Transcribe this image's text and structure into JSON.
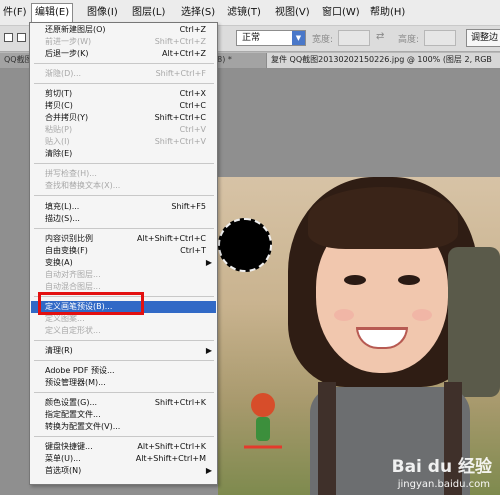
{
  "menubar": {
    "items": [
      "件(F)",
      "编辑(E)",
      "图像(I)",
      "图层(L)",
      "选择(S)",
      "滤镜(T)",
      "视图(V)",
      "窗口(W)",
      "帮助(H)"
    ]
  },
  "options": {
    "mode_value": "正常",
    "width_label": "宽度:",
    "height_label": "高度:",
    "swap_symbol": "⇄",
    "adjust_button": "调整边"
  },
  "tabs": {
    "left": "QQ截图",
    "mid": "(8) *",
    "right": "复件 QQ截图20130202150226.jpg @ 100% (图层 2, RGB"
  },
  "menu": {
    "items": [
      {
        "label": "还原新建图层(O)",
        "shortcut": "Ctrl+Z",
        "disabled": false
      },
      {
        "label": "前进一步(W)",
        "shortcut": "Shift+Ctrl+Z",
        "disabled": true
      },
      {
        "label": "后退一步(K)",
        "shortcut": "Alt+Ctrl+Z",
        "disabled": false
      },
      {
        "label": "渐隐(D)...",
        "shortcut": "Shift+Ctrl+F",
        "disabled": true
      },
      {
        "label": "剪切(T)",
        "shortcut": "Ctrl+X",
        "disabled": false
      },
      {
        "label": "拷贝(C)",
        "shortcut": "Ctrl+C",
        "disabled": false
      },
      {
        "label": "合并拷贝(Y)",
        "shortcut": "Shift+Ctrl+C",
        "disabled": false
      },
      {
        "label": "粘贴(P)",
        "shortcut": "Ctrl+V",
        "disabled": true
      },
      {
        "label": "贴入(I)",
        "shortcut": "Shift+Ctrl+V",
        "disabled": true
      },
      {
        "label": "清除(E)",
        "shortcut": "",
        "disabled": false
      },
      {
        "label": "拼写检查(H)...",
        "shortcut": "",
        "disabled": true
      },
      {
        "label": "查找和替换文本(X)...",
        "shortcut": "",
        "disabled": true
      },
      {
        "label": "填充(L)...",
        "shortcut": "Shift+F5",
        "disabled": false
      },
      {
        "label": "描边(S)...",
        "shortcut": "",
        "disabled": false
      },
      {
        "label": "内容识别比例",
        "shortcut": "Alt+Shift+Ctrl+C",
        "disabled": false
      },
      {
        "label": "自由变换(F)",
        "shortcut": "Ctrl+T",
        "disabled": false
      },
      {
        "label": "变换(A)",
        "shortcut": "",
        "disabled": false,
        "submenu": true
      },
      {
        "label": "自动对齐图层...",
        "shortcut": "",
        "disabled": true
      },
      {
        "label": "自动混合图层...",
        "shortcut": "",
        "disabled": true
      },
      {
        "label": "定义画笔预设(B)...",
        "shortcut": "",
        "disabled": false,
        "highlighted": true
      },
      {
        "label": "定义图案...",
        "shortcut": "",
        "disabled": true
      },
      {
        "label": "定义自定形状...",
        "shortcut": "",
        "disabled": true
      },
      {
        "label": "清理(R)",
        "shortcut": "",
        "disabled": false,
        "submenu": true
      },
      {
        "label": "Adobe PDF 预设...",
        "shortcut": "",
        "disabled": false
      },
      {
        "label": "预设管理器(M)...",
        "shortcut": "",
        "disabled": false
      },
      {
        "label": "颜色设置(G)...",
        "shortcut": "Shift+Ctrl+K",
        "disabled": false
      },
      {
        "label": "指定配置文件...",
        "shortcut": "",
        "disabled": false
      },
      {
        "label": "转换为配置文件(V)...",
        "shortcut": "",
        "disabled": false
      },
      {
        "label": "键盘快捷键...",
        "shortcut": "Alt+Shift+Ctrl+K",
        "disabled": false
      },
      {
        "label": "菜单(U)...",
        "shortcut": "Alt+Shift+Ctrl+M",
        "disabled": false
      },
      {
        "label": "首选项(N)",
        "shortcut": "",
        "disabled": false,
        "submenu": true
      }
    ]
  },
  "watermark": {
    "title": "Bai du 经验",
    "subtitle": "jingyan.baidu.com"
  },
  "colors": {
    "highlight": "#3169c6",
    "callout": "#e31010"
  }
}
